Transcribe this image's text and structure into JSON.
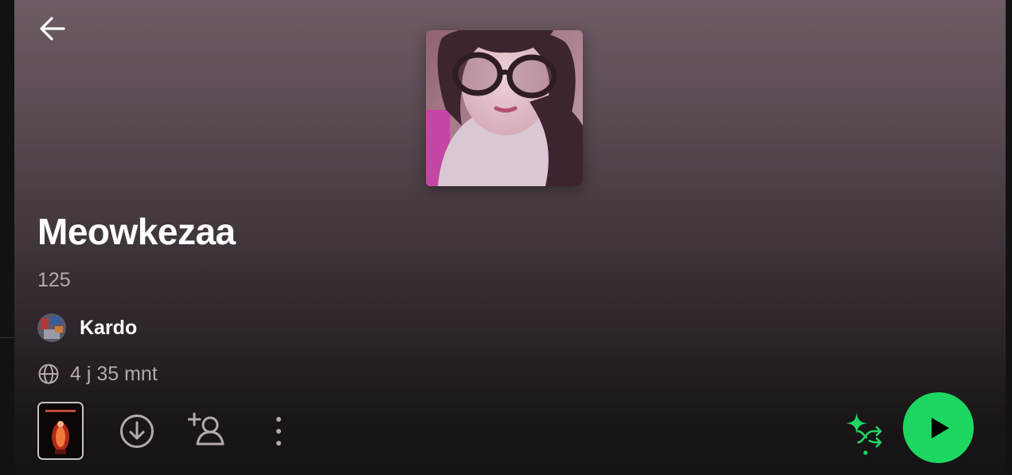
{
  "playlist": {
    "title": "Meowkezaa",
    "subtitle": "125",
    "owner_name": "Kardo",
    "duration": "4 j 35 mnt"
  },
  "icons": {
    "back": "arrow-left-icon",
    "globe": "globe-icon",
    "download": "download-circle-icon",
    "add_user": "add-user-icon",
    "more": "more-vertical-icon",
    "smart_shuffle": "smart-shuffle-icon",
    "play": "play-icon"
  },
  "colors": {
    "accent": "#1ed760",
    "text_primary": "#ffffff",
    "text_secondary": "#b3a9ae",
    "header_gradient_top": "#6e5b66",
    "background": "#121212"
  }
}
